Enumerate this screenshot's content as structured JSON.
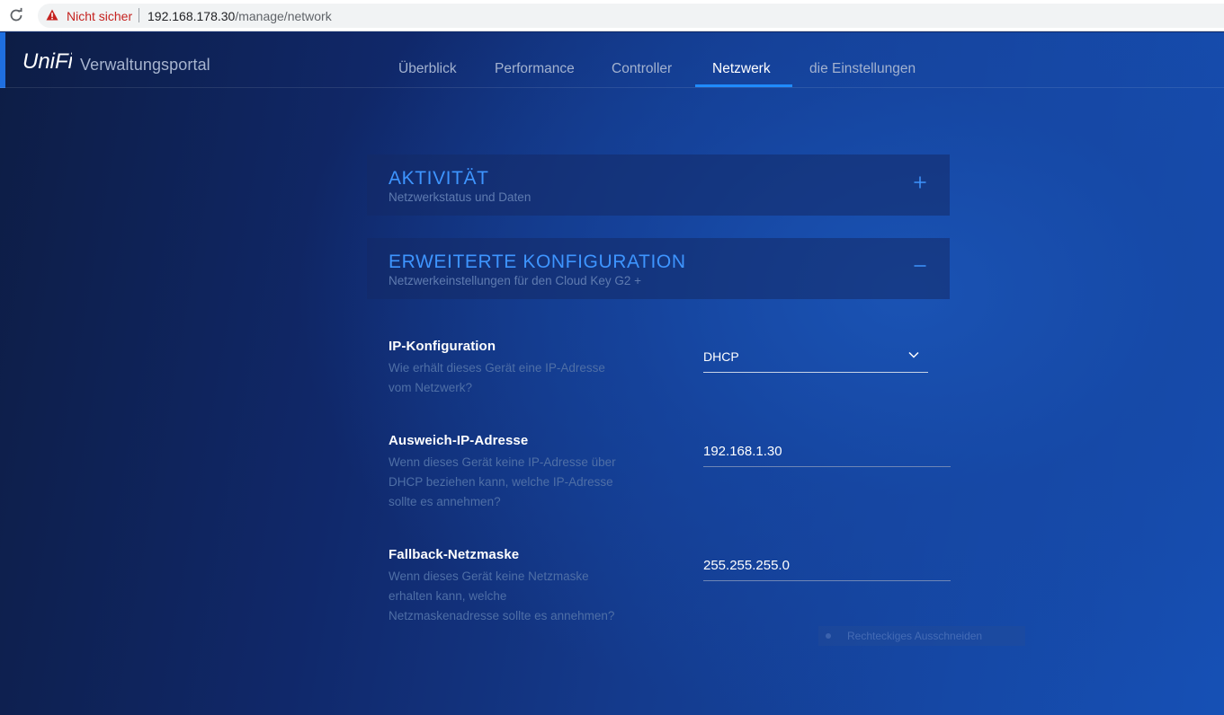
{
  "browser": {
    "security_label": "Nicht sicher",
    "url_host": "192.168.178.30",
    "url_path": "/manage/network"
  },
  "header": {
    "logo_text": "UniFi",
    "portal_title": "Verwaltungsportal",
    "tabs": [
      {
        "label": "Überblick",
        "active": false
      },
      {
        "label": "Performance",
        "active": false
      },
      {
        "label": "Controller",
        "active": false
      },
      {
        "label": "Netzwerk",
        "active": true
      },
      {
        "label": "die Einstellungen",
        "active": false
      }
    ]
  },
  "panels": [
    {
      "title": "AKTIVITÄT",
      "subtitle": "Netzwerkstatus und Daten",
      "toggle": "plus-icon",
      "expanded": false
    },
    {
      "title": "ERWEITERTE KONFIGURATION",
      "subtitle": "Netzwerkeinstellungen für den Cloud Key G2 +",
      "toggle": "minus-icon",
      "expanded": true
    }
  ],
  "form": {
    "ip_config": {
      "label": "IP-Konfiguration",
      "help_lines": [
        "Wie erhält dieses Gerät eine IP-Adresse",
        "vom Netzwerk?"
      ],
      "value": "DHCP"
    },
    "fallback_ip": {
      "label": "Ausweich-IP-Adresse",
      "help_lines": [
        "Wenn dieses Gerät keine IP-Adresse über",
        "DHCP beziehen kann, welche IP-Adresse",
        "sollte es annehmen?"
      ],
      "value": "192.168.1.30"
    },
    "fallback_netmask": {
      "label": "Fallback-Netzmaske",
      "help_lines": [
        "Wenn dieses Gerät keine Netzmaske",
        "erhalten kann, welche",
        "Netzmaskenadresse sollte es annehmen?"
      ],
      "value": "255.255.255.0"
    }
  },
  "overlay": {
    "snip_label": "Rechteckiges Ausschneiden"
  },
  "colors": {
    "accent": "#1f8bff",
    "panel_title": "#3e95ff",
    "warning": "#c5221f"
  }
}
